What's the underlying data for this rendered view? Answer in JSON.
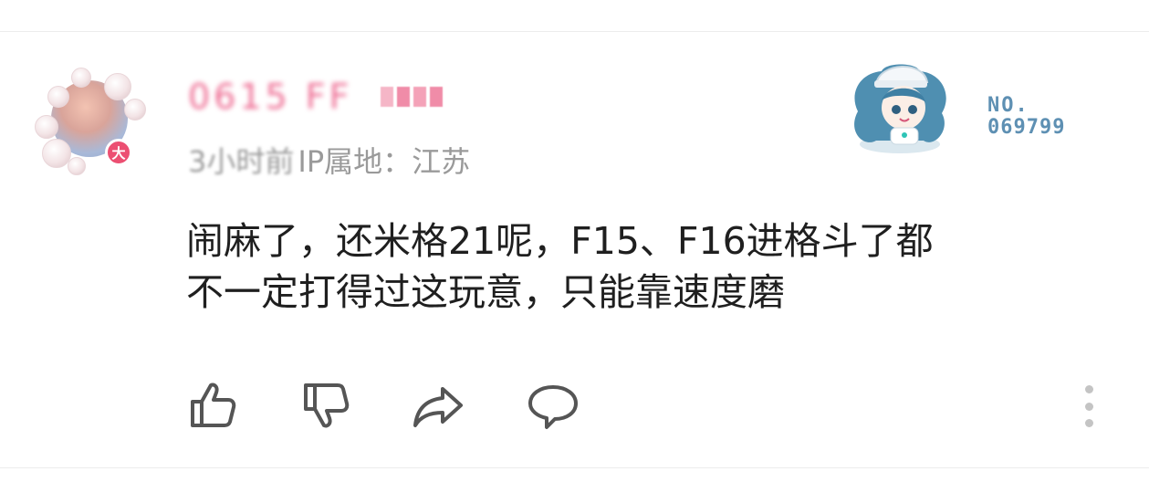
{
  "comment": {
    "author": {
      "name": "0615 FF",
      "badge": "大"
    },
    "meta": {
      "time": "3小时前",
      "location": "IP属地：江苏"
    },
    "text_lines": [
      "闹麻了，还米格21呢，F15、F16进格斗了都",
      "不一定打得过这玩意，只能靠速度磨"
    ],
    "sticker": {
      "label": "NO.",
      "number": "069799",
      "icon": "anime-girl-sticker-icon"
    },
    "actions": {
      "like_icon": "thumbs-up-icon",
      "dislike_icon": "thumbs-down-icon",
      "share_icon": "share-arrow-icon",
      "reply_icon": "chat-bubble-icon",
      "more_icon": "more-vertical-icon"
    }
  },
  "colors": {
    "username": "#ee6a91",
    "badge": "#ec4f72",
    "meta": "#9a9a9a",
    "text": "#1f1f1f",
    "icon": "#555555",
    "sticker_no": "#5e90b3"
  }
}
